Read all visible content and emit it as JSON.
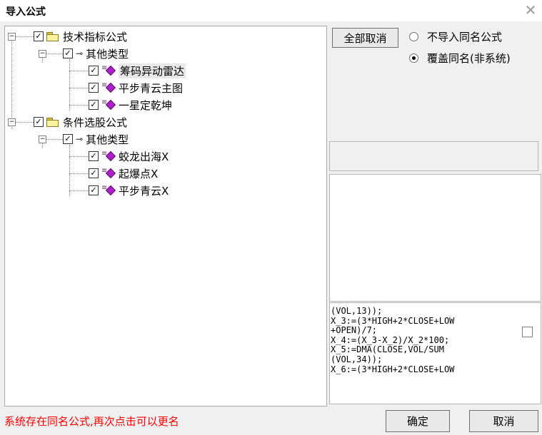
{
  "dialog": {
    "title": "导入公式",
    "close_glyph": "✕"
  },
  "tree": {
    "groups": [
      {
        "label": "技术指标公式",
        "subgroup": "其他类型",
        "items": [
          "筹码异动雷达",
          "平步青云主图",
          "一星定乾坤"
        ]
      },
      {
        "label": "条件选股公式",
        "subgroup": "其他类型",
        "items": [
          "蛟龙出海X",
          "起爆点X",
          "平步青云X"
        ]
      }
    ],
    "expander_glyph": "−",
    "check_glyph": "✓"
  },
  "options": {
    "cancel_all_label": "全部取消",
    "radio_no_import": "不导入同名公式",
    "radio_overwrite": "覆盖同名(非系统)"
  },
  "code_preview": "(VOL,13));\nX_3:=(3*HIGH+2*CLOSE+LOW\n+OPEN)/7;\nX_4:=(X_3-X_2)/X_2*100;\nX_5:=DMA(CLOSE,VOL/SUM\n(VOL,34));\nX_6:=(3*HIGH+2*CLOSE+LOW",
  "status_message": "系统存在同名公式,再次点击可以更名",
  "buttons": {
    "ok": "确定",
    "cancel": "取消"
  },
  "icons": {
    "folder": "folder-icon",
    "key": "key-icon",
    "formula": "formula-icon"
  }
}
